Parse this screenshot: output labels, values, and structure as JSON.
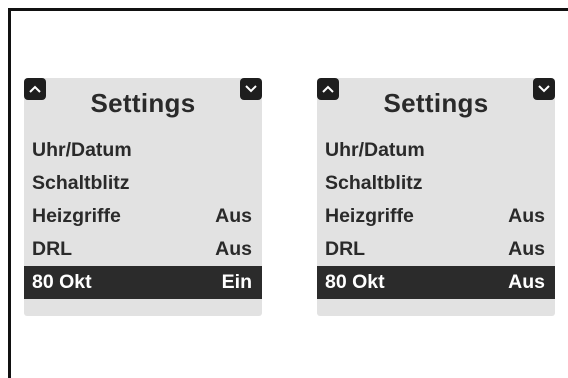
{
  "screens": [
    {
      "title": "Settings",
      "items": [
        {
          "label": "Uhr/Datum",
          "value": ""
        },
        {
          "label": "Schaltblitz",
          "value": ""
        },
        {
          "label": "Heizgriffe",
          "value": "Aus"
        },
        {
          "label": "DRL",
          "value": "Aus"
        },
        {
          "label": "80 Okt",
          "value": "Ein",
          "selected": true
        }
      ]
    },
    {
      "title": "Settings",
      "items": [
        {
          "label": "Uhr/Datum",
          "value": ""
        },
        {
          "label": "Schaltblitz",
          "value": ""
        },
        {
          "label": "Heizgriffe",
          "value": "Aus"
        },
        {
          "label": "DRL",
          "value": "Aus"
        },
        {
          "label": "80 Okt",
          "value": "Aus",
          "selected": true
        }
      ]
    }
  ],
  "icons": {
    "up": "chevron-up-icon",
    "down": "chevron-down-icon"
  },
  "colors": {
    "screen_bg": "#e2e2e2",
    "selected_bg": "#2b2b2b",
    "text": "#2a2a2a"
  }
}
